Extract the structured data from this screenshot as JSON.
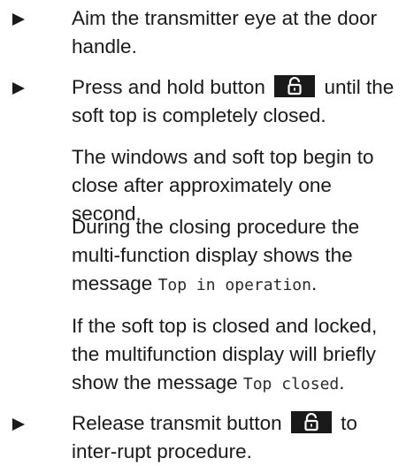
{
  "instructions": {
    "step1": "Aim the transmitter eye at the door handle.",
    "step2_before": "Press and hold button",
    "step2_after": "until the soft top is completely closed.",
    "note1": "The windows and soft top begin to close after approximately one second.",
    "note2_before": "During the closing procedure the multi-function display shows the message",
    "note2_code": "Top in operation",
    "note2_after": ".",
    "note3_before": "If the soft top is closed and locked, the multifunction display will briefly show the message",
    "note3_code": "Top closed",
    "note3_after": ".",
    "step3_before": "Release transmit button",
    "step3_after": "to inter-rupt procedure."
  },
  "icons": {
    "bullet": "triangle-bullet-icon",
    "button": "lock-icon"
  },
  "colors": {
    "text": "#1a1a1a",
    "button_bg": "#1a1a1a",
    "button_icon": "#ffffff"
  }
}
